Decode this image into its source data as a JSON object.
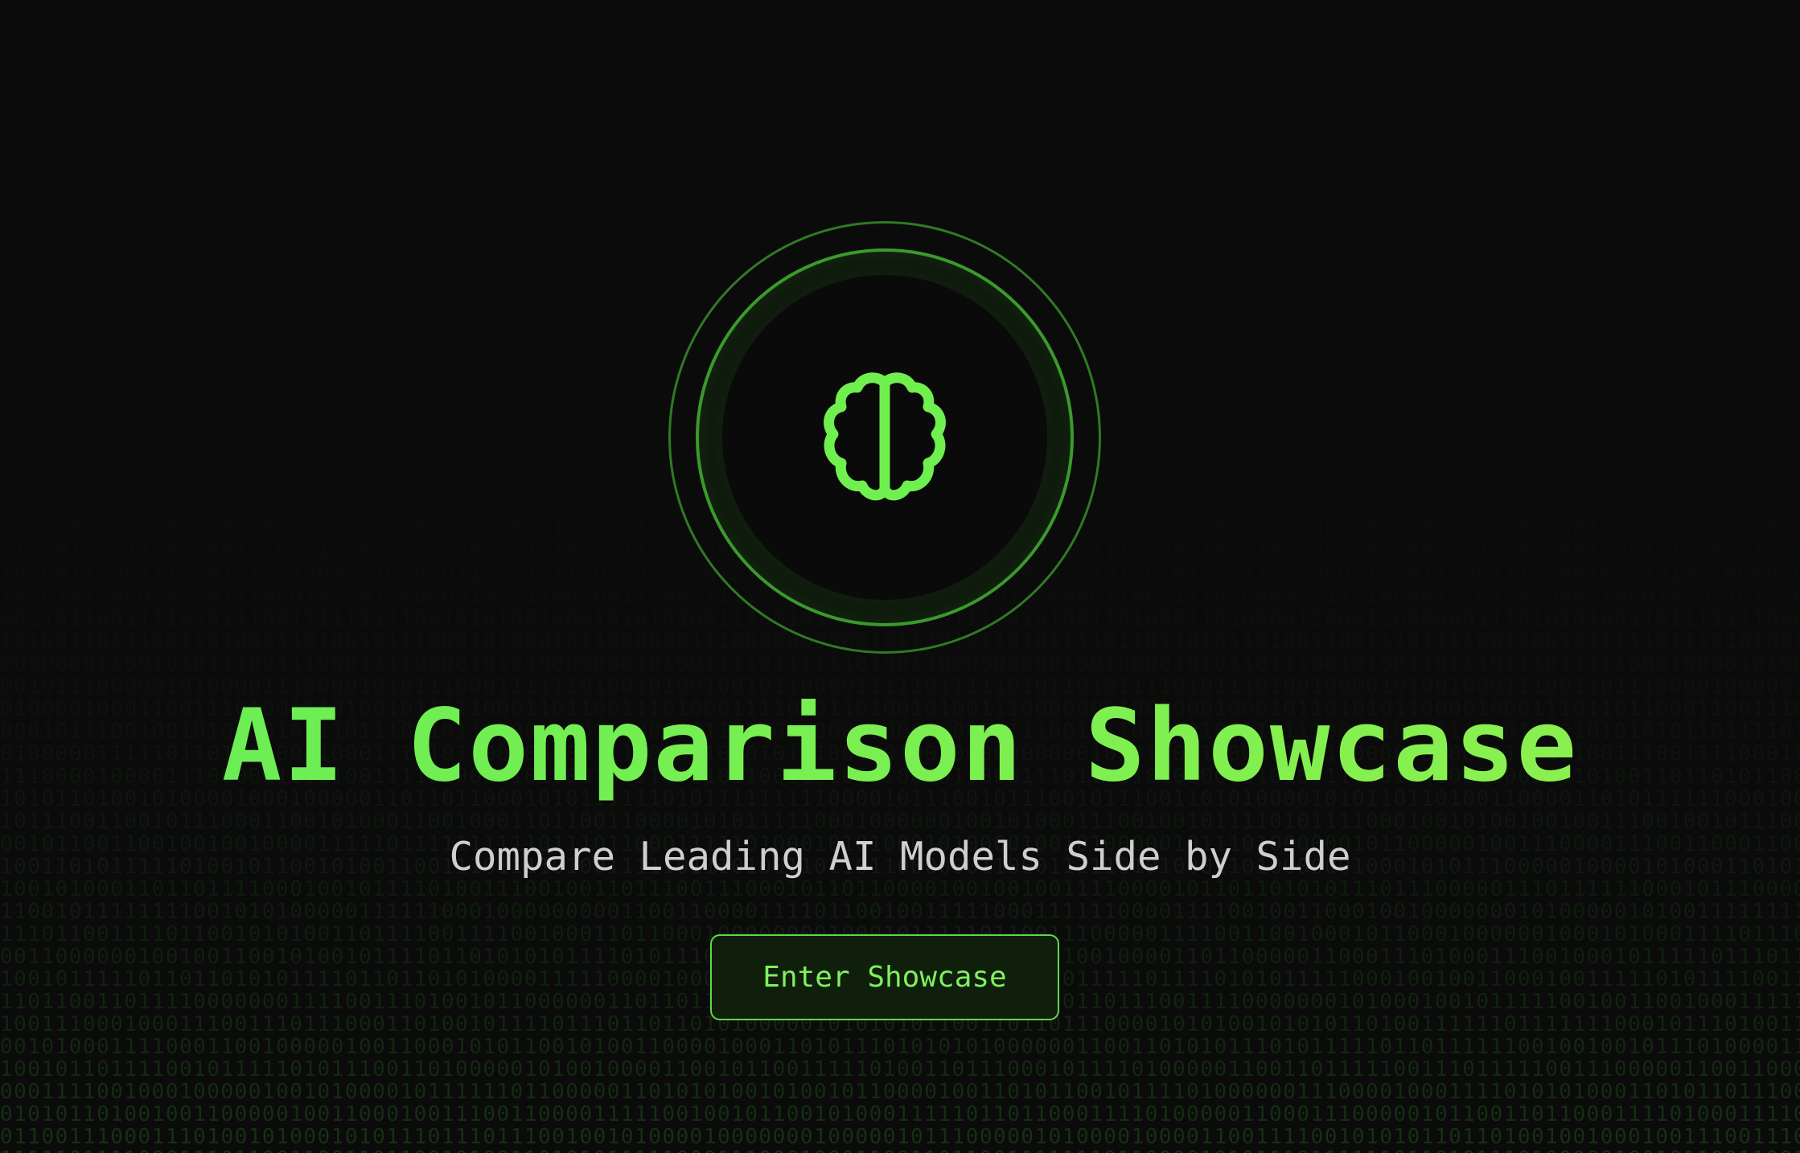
{
  "hero": {
    "icon": "brain-icon",
    "title": "AI Comparison Showcase",
    "subtitle": "Compare Leading AI Models Side by Side",
    "button_label": "Enter Showcase"
  },
  "colors": {
    "background": "#0b0b0b",
    "accent": "#6fe84f",
    "ring": "#3a9a2c",
    "subtitle": "#cfcfcf"
  }
}
